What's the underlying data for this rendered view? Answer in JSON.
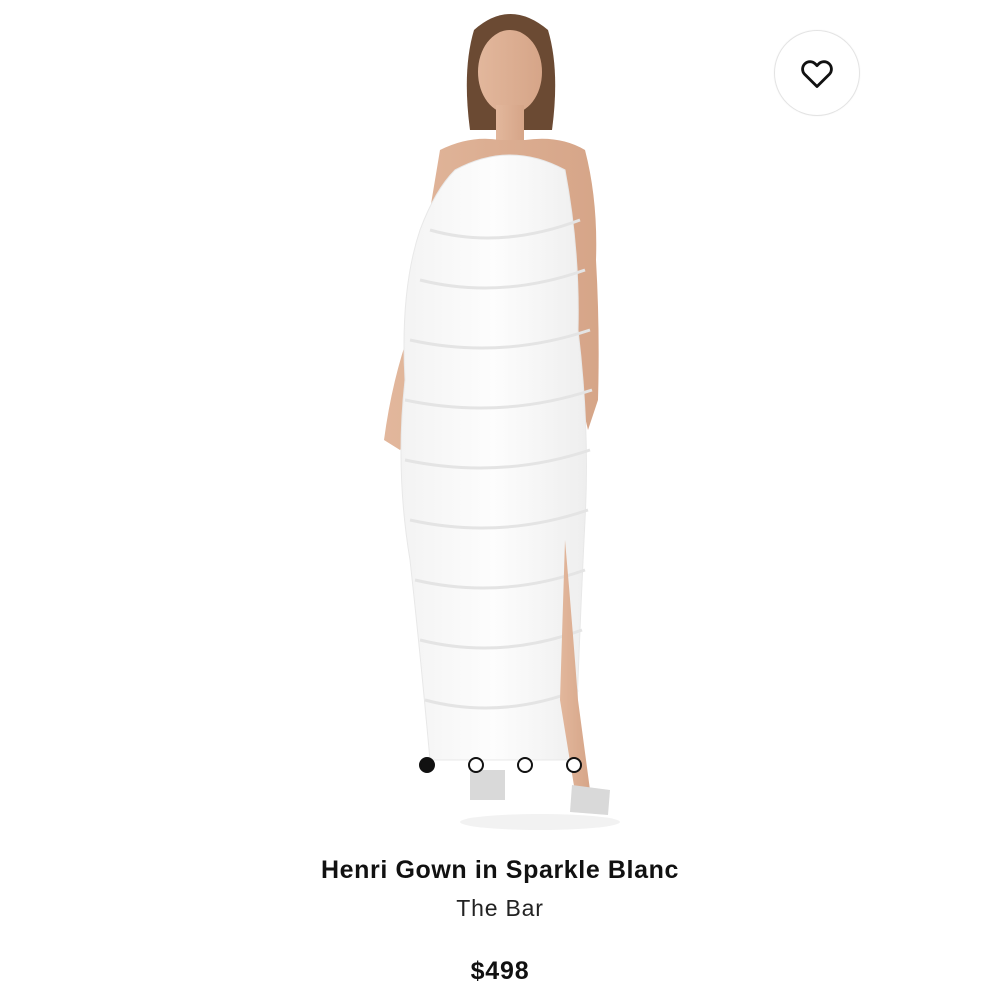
{
  "product": {
    "title": "Henri Gown in Sparkle Blanc",
    "brand": "The Bar",
    "price": "$498"
  },
  "gallery": {
    "image_count": 4,
    "active_index": 0,
    "image_description_icon": "model-in-white-ruffled-gown-photo"
  },
  "wishlist": {
    "icon": "heart-icon"
  },
  "colors": {
    "background": "#ffffff",
    "text": "#111111",
    "dot_active": "#111111"
  }
}
